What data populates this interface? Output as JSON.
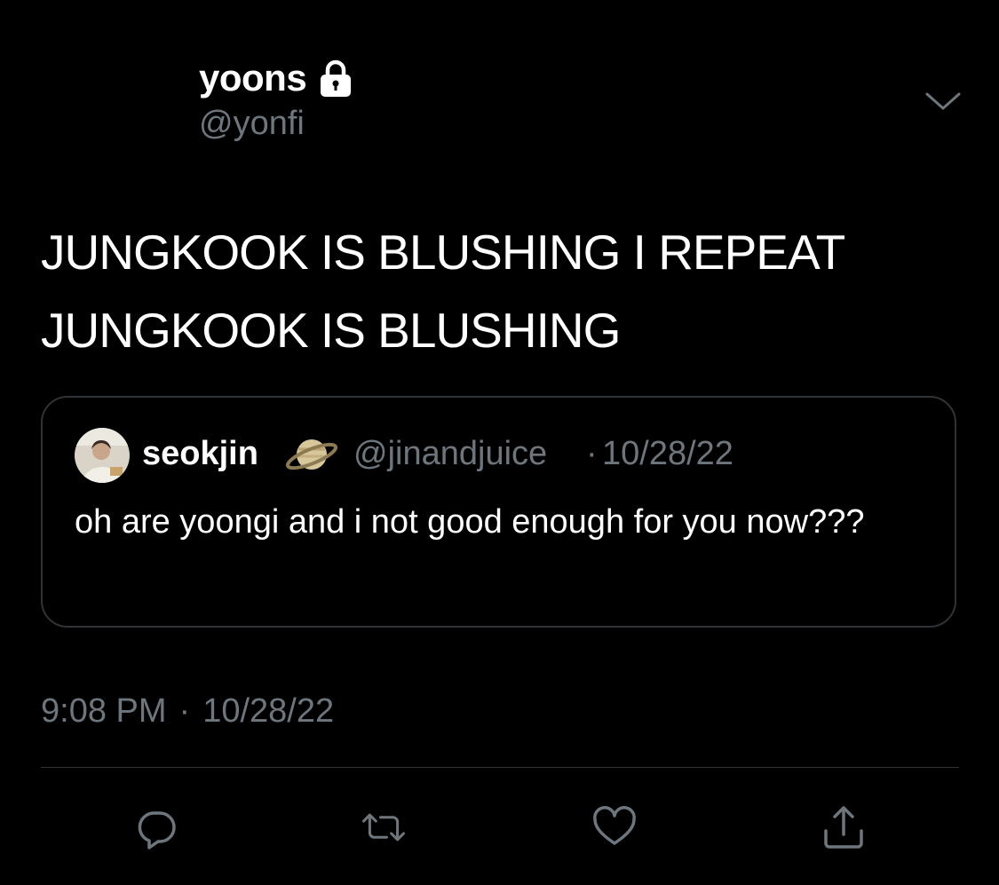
{
  "tweet": {
    "author": {
      "display_name": "yoons",
      "handle": "@yonfi",
      "protected_icon": "lock-icon"
    },
    "text_line1": "JUNGKOOK IS BLUSHING I REPEAT",
    "text_line2": "JUNGKOOK IS BLUSHING",
    "quoted": {
      "display_name": "seokjin",
      "emoji_icon": "planet-icon",
      "handle": "@jinandjuice",
      "separator": "·",
      "date": "10/28/22",
      "text": "oh are yoongi and i not good enough for you now???"
    },
    "time": "9:08 PM",
    "time_separator": "·",
    "date": "10/28/22",
    "actions": [
      "reply-icon",
      "retweet-icon",
      "like-icon",
      "share-icon"
    ]
  },
  "colors": {
    "background": "#000000",
    "text": "#ffffff",
    "secondary": "#6e767d",
    "border": "#2f3336"
  }
}
